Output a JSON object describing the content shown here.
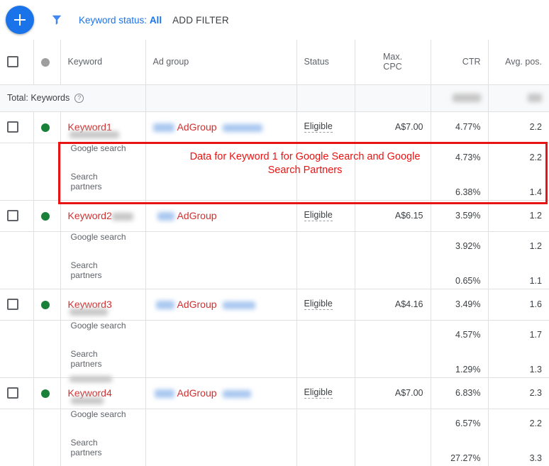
{
  "toolbar": {
    "add_button_label": "+",
    "filter_icon": "filter-funnel-icon",
    "keyword_status_label": "Keyword status:",
    "keyword_status_value": "All",
    "add_filter_label": "ADD FILTER",
    "accent_color": "#1a73e8"
  },
  "table": {
    "columns": [
      {
        "key": "select",
        "label": ""
      },
      {
        "key": "dot",
        "label": ""
      },
      {
        "key": "keyword",
        "label": "Keyword"
      },
      {
        "key": "ad_group",
        "label": "Ad group"
      },
      {
        "key": "status",
        "label": "Status"
      },
      {
        "key": "max_cpc",
        "label": "Max. CPC",
        "line1": "Max.",
        "line2": "CPC"
      },
      {
        "key": "ctr",
        "label": "CTR"
      },
      {
        "key": "avg_pos",
        "label": "Avg. pos."
      }
    ],
    "total_row": {
      "label": "Total: Keywords",
      "help_icon": "question-mark-icon",
      "ctr": "",
      "avg_pos": ""
    },
    "sub_row_labels": {
      "google_search": "Google search",
      "search_partners_line1": "Search",
      "search_partners_line2": "partners"
    },
    "rows": [
      {
        "keyword": "Keyword1",
        "ad_group": "AdGroup",
        "status": "Eligible",
        "max_cpc": "A$7.00",
        "ctr": "4.77%",
        "avg_pos": "2.2",
        "status_dot": "green",
        "segments": [
          {
            "name": "Google search",
            "ctr": "4.73%",
            "avg_pos": "2.2"
          },
          {
            "name": "Search partners",
            "ctr": "6.38%",
            "avg_pos": "1.4"
          }
        ]
      },
      {
        "keyword": "Keyword2",
        "ad_group": "AdGroup",
        "status": "Eligible",
        "max_cpc": "A$6.15",
        "ctr": "3.59%",
        "avg_pos": "1.2",
        "status_dot": "green",
        "segments": [
          {
            "name": "Google search",
            "ctr": "3.92%",
            "avg_pos": "1.2"
          },
          {
            "name": "Search partners",
            "ctr": "0.65%",
            "avg_pos": "1.1"
          }
        ]
      },
      {
        "keyword": "Keyword3",
        "ad_group": "AdGroup",
        "status": "Eligible",
        "max_cpc": "A$4.16",
        "ctr": "3.49%",
        "avg_pos": "1.6",
        "status_dot": "green",
        "segments": [
          {
            "name": "Google search",
            "ctr": "4.57%",
            "avg_pos": "1.7"
          },
          {
            "name": "Search partners",
            "ctr": "1.29%",
            "avg_pos": "1.3"
          }
        ]
      },
      {
        "keyword": "Keyword4",
        "ad_group": "AdGroup",
        "status": "Eligible",
        "max_cpc": "A$7.00",
        "ctr": "6.83%",
        "avg_pos": "2.3",
        "status_dot": "green",
        "segments": [
          {
            "name": "Google search",
            "ctr": "6.57%",
            "avg_pos": "2.2"
          },
          {
            "name": "Search partners",
            "ctr": "27.27%",
            "avg_pos": "3.3"
          }
        ]
      }
    ]
  },
  "annotation": {
    "text": "Data for Keyword 1 for Google Search and Google Search Partners",
    "color": "#ee1111"
  }
}
